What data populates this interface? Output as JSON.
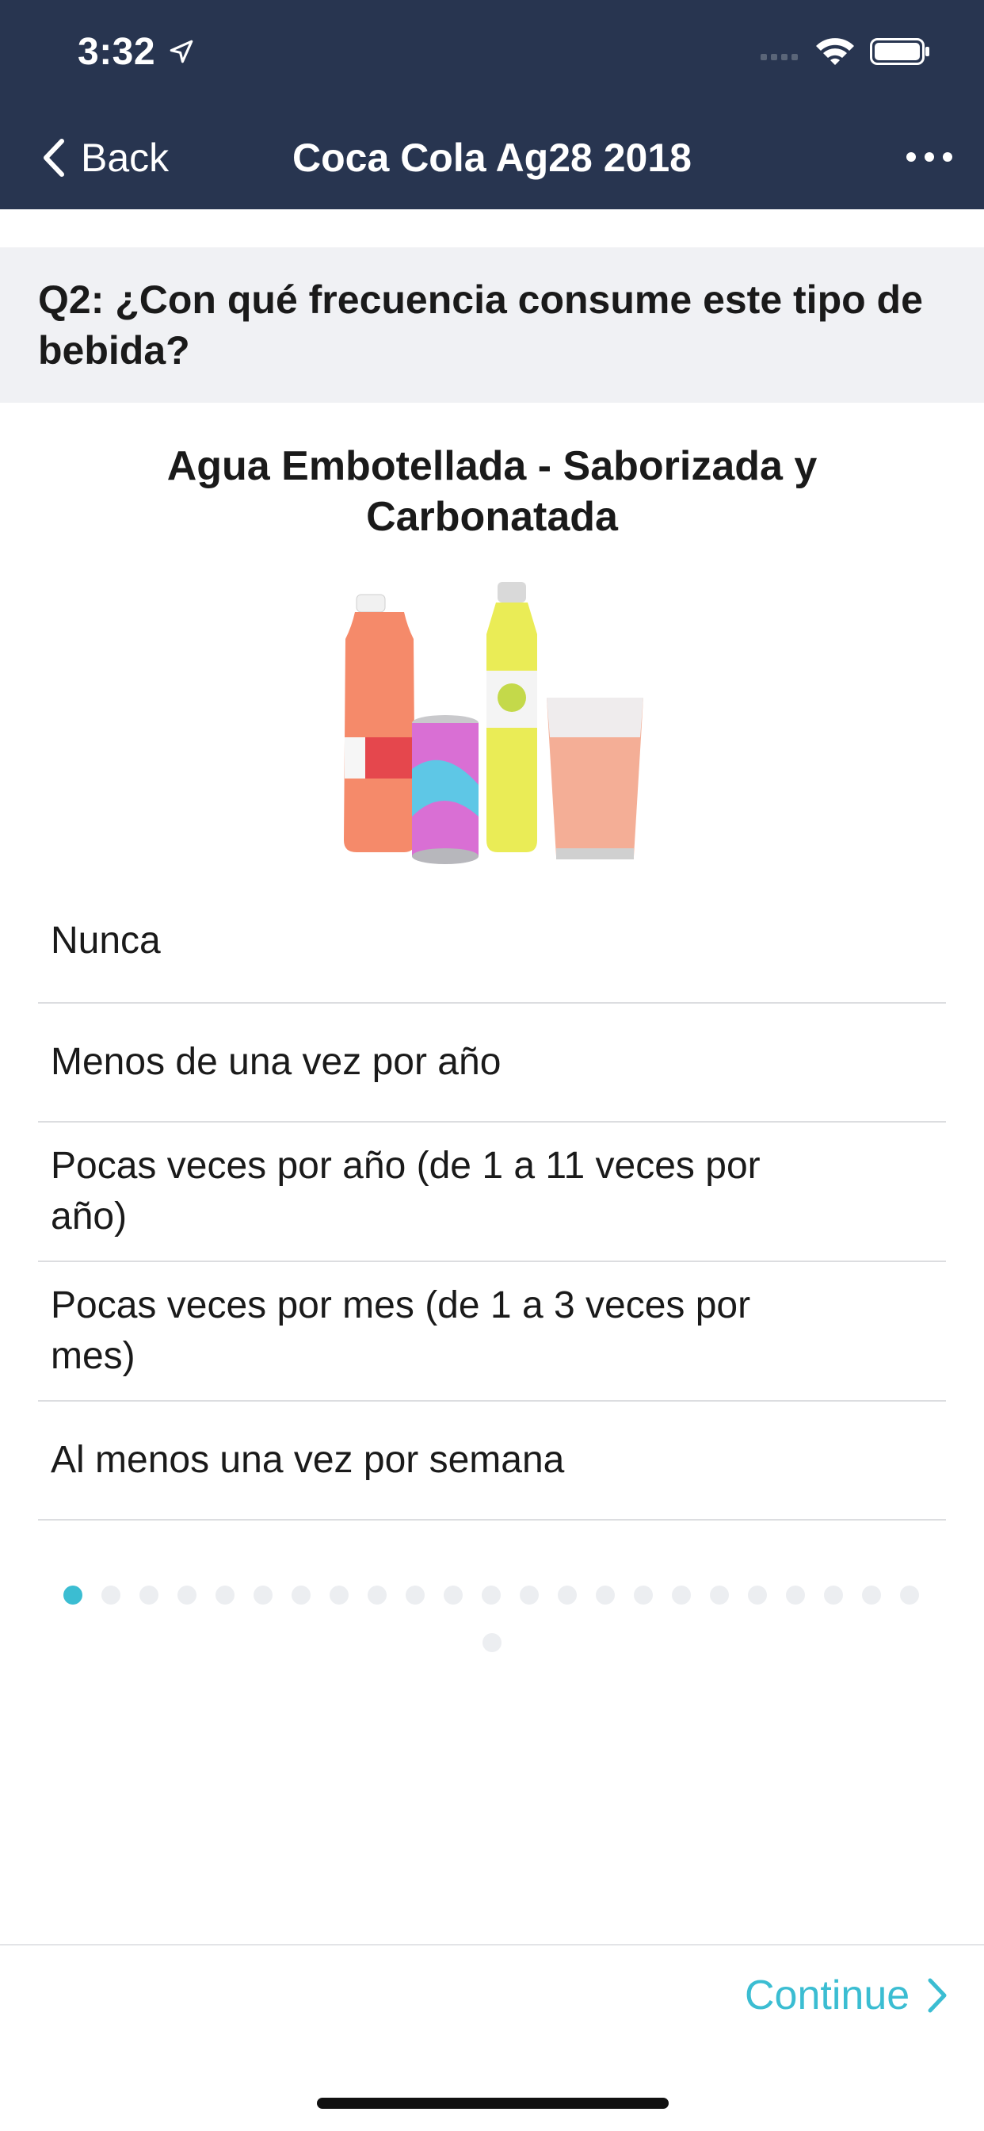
{
  "status_bar": {
    "time": "3:32"
  },
  "nav": {
    "back_label": "Back",
    "title": "Coca Cola Ag28 2018"
  },
  "question": {
    "text": "Q2: ¿Con qué frecuencia consume este tipo de bebida?"
  },
  "product": {
    "title": "Agua Embotellada - Saborizada y Carbonatada"
  },
  "options": [
    "Nunca",
    "Menos de una vez por año",
    "Pocas veces por año (de 1 a 11 veces por año)",
    "Pocas veces por mes (de 1 a 3 veces por mes)",
    "Al menos una vez por semana"
  ],
  "pagination": {
    "total": 24,
    "current": 1
  },
  "footer": {
    "continue_label": "Continue"
  },
  "colors": {
    "nav_bg": "#283550",
    "accent": "#3bbdd2",
    "question_bg": "#f0f1f4"
  }
}
